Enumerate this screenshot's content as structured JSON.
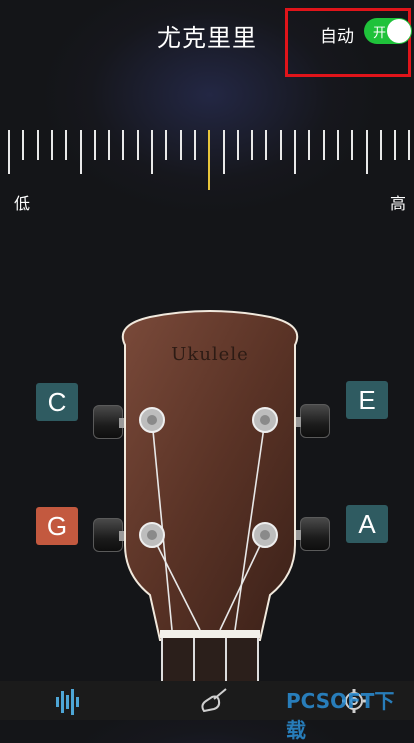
{
  "header": {
    "title": "尤克里里",
    "auto_label": "自动",
    "toggle_label": "开",
    "toggle_on": true
  },
  "ruler": {
    "low_label": "低",
    "high_label": "高"
  },
  "headstock": {
    "brand": "Ukulele"
  },
  "strings": [
    {
      "note": "C"
    },
    {
      "note": "E"
    },
    {
      "note": "G"
    },
    {
      "note": "A"
    }
  ],
  "tabs": [
    {
      "icon": "tuner-waveform-icon"
    },
    {
      "icon": "guitar-icon"
    },
    {
      "icon": "gear-icon"
    }
  ],
  "watermark": "PCSOFT下载",
  "colors": {
    "accent_green": "#1fc23a",
    "note_teal": "#2f5b61",
    "note_orange": "#c3593f",
    "center_tick": "#e8c53b",
    "highlight_red": "#e0141a"
  }
}
